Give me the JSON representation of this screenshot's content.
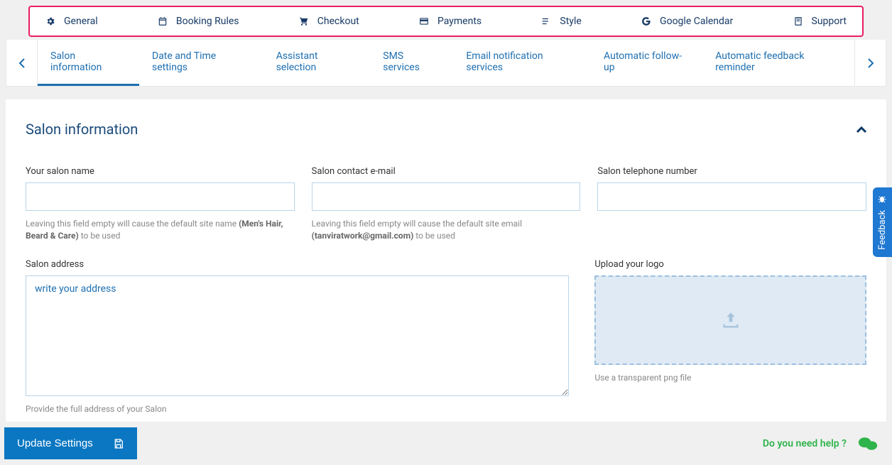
{
  "mainTabs": {
    "general": "General",
    "booking": "Booking Rules",
    "checkout": "Checkout",
    "payments": "Payments",
    "style": "Style",
    "gcal": "Google Calendar",
    "support": "Support"
  },
  "subTabs": {
    "salonInfo": "Salon information",
    "dateTime": "Date and Time settings",
    "assistant": "Assistant selection",
    "sms": "SMS services",
    "email": "Email notification services",
    "followup": "Automatic follow-up",
    "feedback": "Automatic feedback reminder"
  },
  "panel": {
    "title": "Salon information"
  },
  "fields": {
    "name": {
      "label": "Your salon name",
      "help_pre": "Leaving this field empty will cause the default site name ",
      "help_bold": "(Men's Hair, Beard & Care)",
      "help_post": " to be used"
    },
    "email": {
      "label": "Salon contact e-mail",
      "help_pre": "Leaving this field empty will cause the default site email ",
      "help_bold": "(tanviratwork@gmail.com)",
      "help_post": " to be used"
    },
    "phone": {
      "label": "Salon telephone number"
    },
    "address": {
      "label": "Salon address",
      "placeholder": "write your address",
      "help": "Provide the full address of your Salon"
    },
    "logo": {
      "label": "Upload your logo",
      "help": "Use a transparent png file"
    }
  },
  "footer": {
    "update": "Update Settings",
    "help": "Do you need help ?"
  },
  "feedback": "Feedback"
}
